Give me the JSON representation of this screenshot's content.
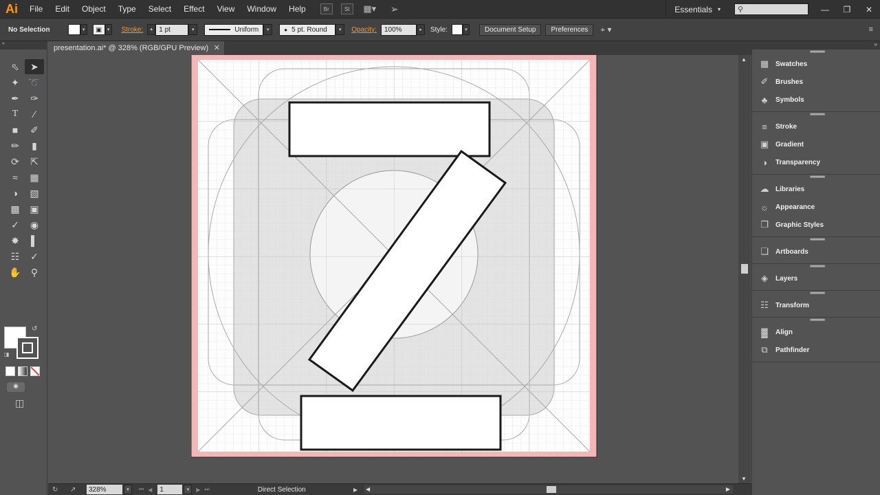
{
  "app": {
    "logo": "Ai",
    "menus": [
      "File",
      "Edit",
      "Object",
      "Type",
      "Select",
      "Effect",
      "View",
      "Window",
      "Help"
    ],
    "bridge_label": "Br",
    "stock_label": "St",
    "workspace": "Essentials"
  },
  "control_bar": {
    "selection": "No Selection",
    "stroke_label": "Stroke:",
    "stroke_weight": "1 pt",
    "profile": "Uniform",
    "brush": "5 pt. Round",
    "opacity_label": "Opacity:",
    "opacity": "100%",
    "style_label": "Style:",
    "document_setup": "Document Setup",
    "preferences": "Preferences"
  },
  "document": {
    "tab_title": "presentation.ai* @ 328% (RGB/GPU Preview)",
    "zoom": "328%",
    "artboard_number": "1",
    "status": "Direct Selection"
  },
  "panels": {
    "groups": [
      [
        {
          "label": "Swatches",
          "icon": "swatches-icon"
        },
        {
          "label": "Brushes",
          "icon": "brushes-icon"
        },
        {
          "label": "Symbols",
          "icon": "symbols-icon"
        }
      ],
      [
        {
          "label": "Stroke",
          "icon": "stroke-icon"
        },
        {
          "label": "Gradient",
          "icon": "gradient-icon"
        },
        {
          "label": "Transparency",
          "icon": "transparency-icon"
        }
      ],
      [
        {
          "label": "Libraries",
          "icon": "libraries-icon"
        },
        {
          "label": "Appearance",
          "icon": "appearance-icon"
        },
        {
          "label": "Graphic Styles",
          "icon": "graphic-styles-icon"
        }
      ],
      [
        {
          "label": "Artboards",
          "icon": "artboards-icon"
        }
      ],
      [
        {
          "label": "Layers",
          "icon": "layers-icon"
        }
      ],
      [
        {
          "label": "Transform",
          "icon": "transform-icon"
        }
      ],
      [
        {
          "label": "Align",
          "icon": "align-icon"
        },
        {
          "label": "Pathfinder",
          "icon": "pathfinder-icon"
        }
      ]
    ]
  },
  "colors": {
    "accent": "#f29a2e",
    "artboard_bleed": "#f4b6b6",
    "fill": "#ffffff",
    "shape_stroke": "#1a1a1a"
  }
}
